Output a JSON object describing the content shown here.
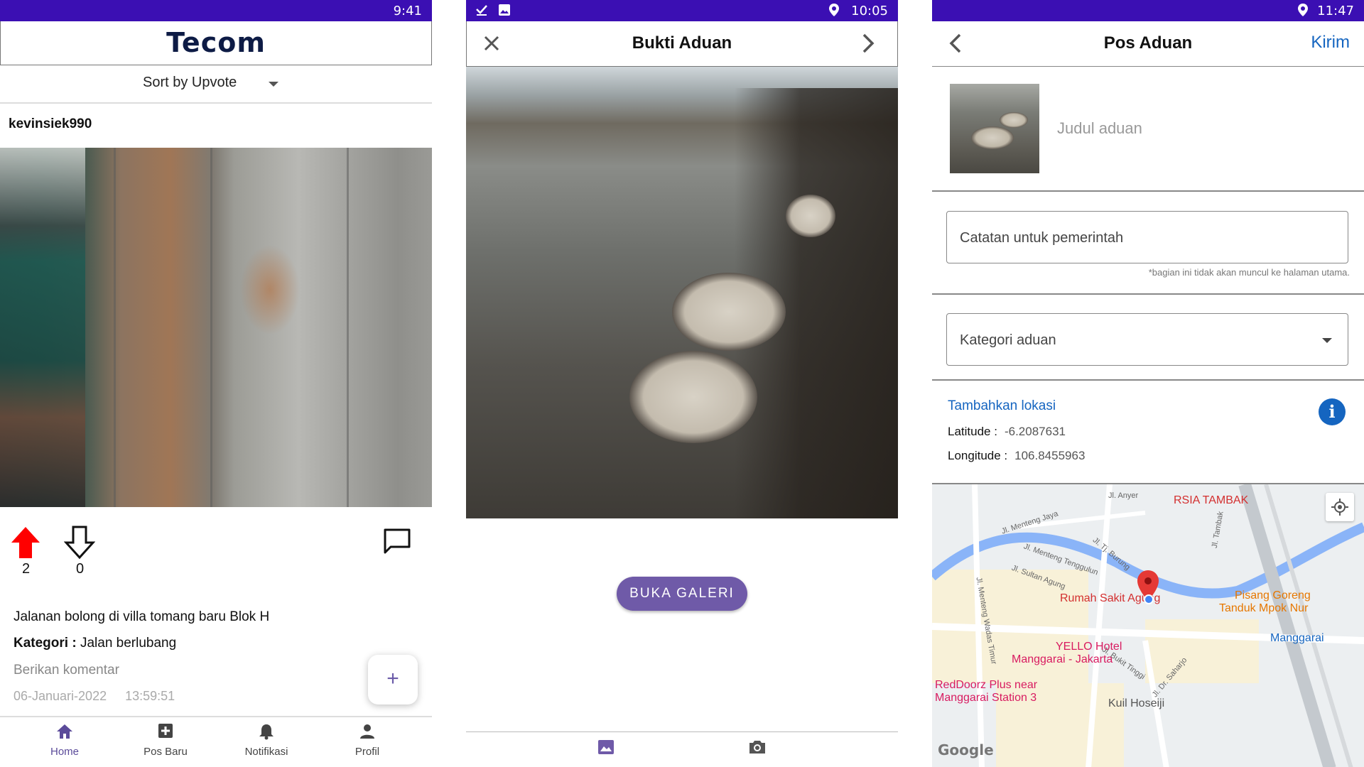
{
  "screen1": {
    "status_time": "9:41",
    "brand": "Tecom",
    "sort_label": "Sort by Upvote",
    "username": "kevinsiek990",
    "upvote_count": "2",
    "downvote_count": "0",
    "description": "Jalanan bolong di villa tomang baru Blok H",
    "category_label": "Kategori :",
    "category_value": "Jalan berlubang",
    "comment_placeholder": "Berikan komentar",
    "date": "06-Januari-2022",
    "time": "13:59:51",
    "fab_label": "+",
    "nav": [
      {
        "label": "Home",
        "icon": "home-icon"
      },
      {
        "label": "Pos Baru",
        "icon": "add-box-icon"
      },
      {
        "label": "Notifikasi",
        "icon": "bell-icon"
      },
      {
        "label": "Profil",
        "icon": "person-icon"
      }
    ],
    "colors": {
      "status_bar": "#3b0fb3",
      "accent": "#5b4b9a",
      "upvote": "#ff0000"
    }
  },
  "screen2": {
    "status_time": "10:05",
    "title": "Bukti Aduan",
    "gallery_button": "BUKA GALERI",
    "bottom_icons": [
      "image-icon",
      "camera-icon"
    ]
  },
  "screen3": {
    "status_time": "11:47",
    "title": "Pos Aduan",
    "send_label": "Kirim",
    "title_placeholder": "Judul aduan",
    "note_placeholder": "Catatan untuk pemerintah",
    "note_hint": "*bagian ini tidak akan muncul ke halaman utama.",
    "category_placeholder": "Kategori aduan",
    "add_location": "Tambahkan lokasi",
    "latitude_label": "Latitude :",
    "latitude_value": "-6.2087631",
    "longitude_label": "Longitude :",
    "longitude_value": "106.8455963",
    "map": {
      "places": {
        "rsia": "RSIA TAMBAK",
        "rumah_sakit": "Rumah Sakit Agung",
        "pisang_1": "Pisang Goreng",
        "pisang_2": "Tanduk Mpok Nur",
        "manggarai": "Manggarai",
        "yello_1": "YELLO Hotel",
        "yello_2": "Manggarai - Jakarta",
        "reddoorz_1": "RedDoorz Plus near",
        "reddoorz_2": "Manggarai Station 3",
        "kuil": "Kuil Hoseiji",
        "google": "Google"
      },
      "roads": {
        "anyer": "Jl. Anyer",
        "menteng_jaya": "Jl. Menteng Jaya",
        "tj_burung": "Jl. Tj. Burung",
        "menteng_tenggulun": "Jl. Menteng Tenggulun",
        "sultan_agung": "Jl. Sultan Agung",
        "tambak": "Jl. Tambak",
        "menteng_wadas": "Jl. Menteng Wadas Timur",
        "bukit_tinggi": "Jl. Bukit Tinggi",
        "sahardjo": "Jl. Dr. Saharjo"
      }
    }
  }
}
